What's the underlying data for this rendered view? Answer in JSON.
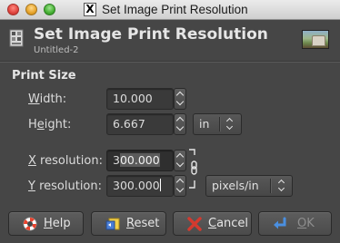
{
  "window": {
    "title": "Set Image Print Resolution"
  },
  "header": {
    "title": "Set Image Print Resolution",
    "subtitle": "Untitled-2"
  },
  "print_size": {
    "section_label": "Print Size",
    "width": {
      "mnemonic": "W",
      "rest": "idth:",
      "value": "10.000"
    },
    "height": {
      "mnemonic": "e",
      "pre": "H",
      "rest": "ight:",
      "value": "6.667"
    },
    "size_unit": "in",
    "x_resolution": {
      "mnemonic": "X",
      "rest": " resolution:",
      "value_before": "3",
      "value_selected": "00.000"
    },
    "y_resolution": {
      "mnemonic": "Y",
      "rest": " resolution:",
      "value": "300.000"
    },
    "resolution_unit": "pixels/in"
  },
  "buttons": {
    "help": {
      "mnemonic": "H",
      "rest": "elp"
    },
    "reset": {
      "mnemonic": "R",
      "rest": "eset"
    },
    "cancel": {
      "mnemonic": "C",
      "rest": "ancel"
    },
    "ok": {
      "mnemonic": "O",
      "rest": "K"
    }
  },
  "colors": {
    "background": "#464646",
    "text": "#e6e6e6",
    "cancel_icon": "#d43a2f",
    "help_icon": "#e8432e",
    "ok_icon": "#4a8fe0"
  },
  "icons": {
    "header": "image-print-icon",
    "help": "lifebuoy-icon",
    "reset": "reset-icon",
    "cancel": "cancel-x-icon",
    "ok": "enter-arrow-icon",
    "chain": "chain-link-icon"
  }
}
